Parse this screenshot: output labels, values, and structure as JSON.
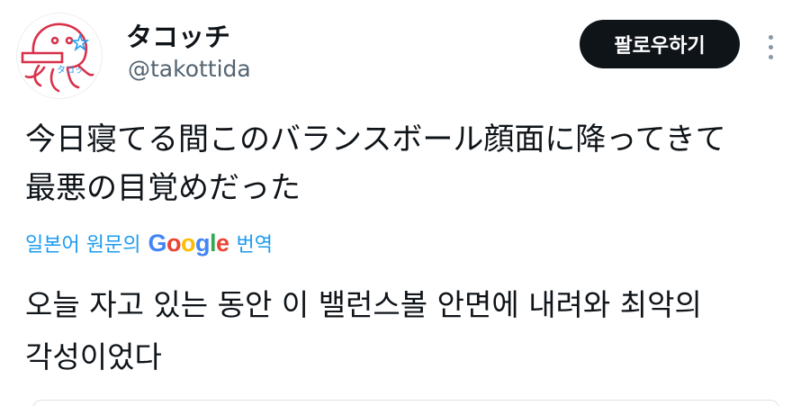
{
  "author": {
    "display_name": "タコッチ",
    "handle": "@takottida",
    "avatar_icon": "octopus-mascot-icon",
    "avatar_text": "タコッ"
  },
  "actions": {
    "follow_label": "팔로우하기",
    "more_icon": "more-vertical-icon"
  },
  "tweet": {
    "text_line1": "今日寝てる間このバランスボール顔面に降ってきて",
    "text_line2": "最悪の目覚めだった"
  },
  "translation": {
    "source_label": "일본어 원문의",
    "provider_letters": [
      "G",
      "o",
      "o",
      "g",
      "l",
      "e"
    ],
    "provider_colors": [
      "#4285F4",
      "#EA4335",
      "#FBBC05",
      "#4285F4",
      "#34A853",
      "#EA4335"
    ],
    "action_label": "번역",
    "text_line1": "오늘 자고 있는 동안 이 밸런스볼 안면에 내려와 최악의",
    "text_line2": "각성이었다"
  },
  "colors": {
    "text": "#0f1419",
    "secondary": "#536471",
    "link": "#1d9bf0",
    "button_bg": "#0f1419",
    "avatar_stroke": "#d9304a"
  }
}
